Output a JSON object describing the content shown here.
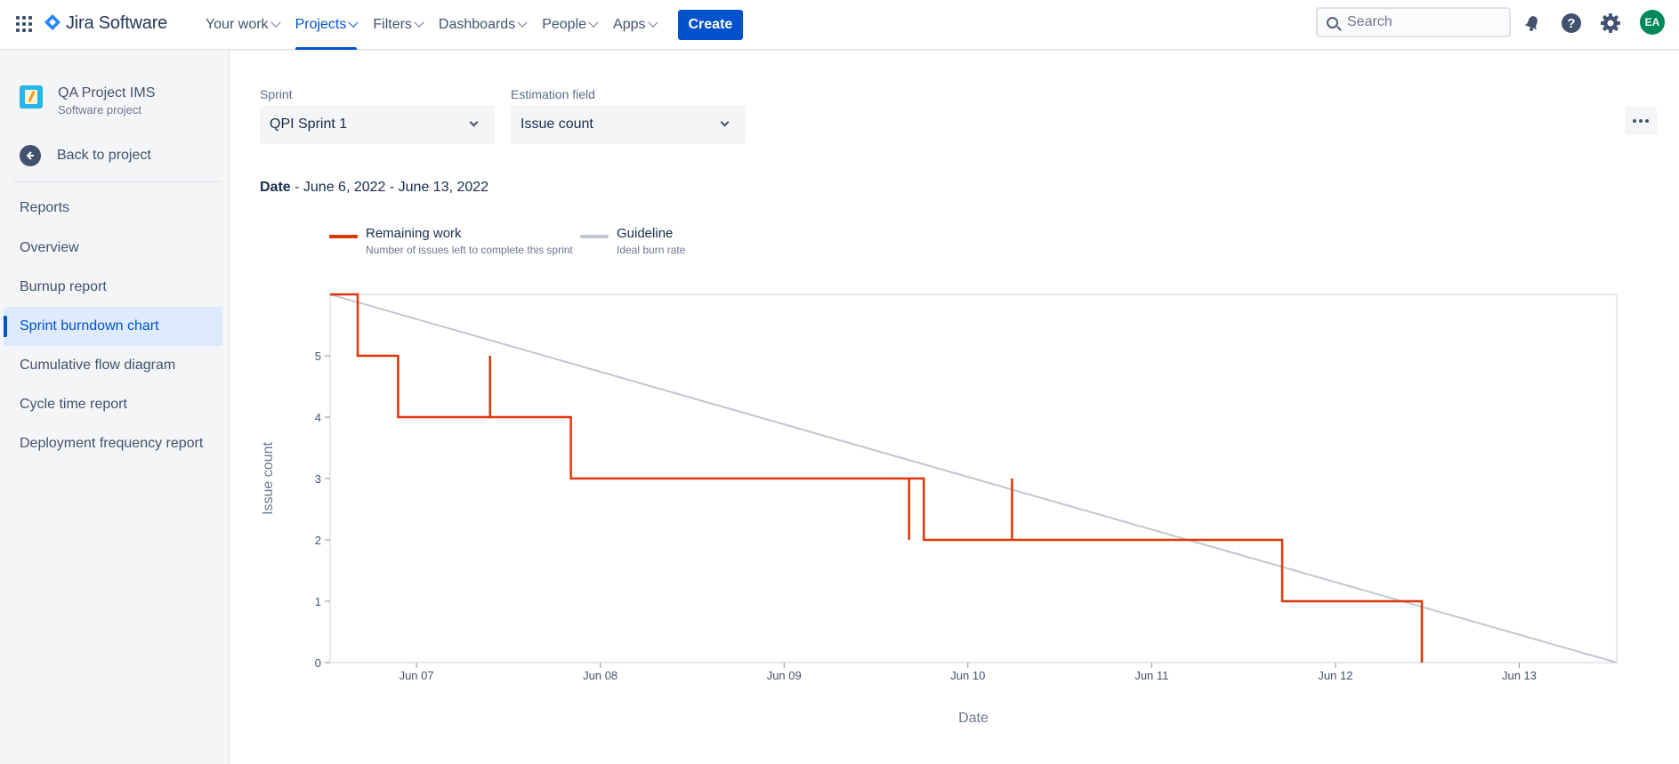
{
  "nav": {
    "product": "Jira Software",
    "items": [
      {
        "label": "Your work",
        "active": false
      },
      {
        "label": "Projects",
        "active": true
      },
      {
        "label": "Filters",
        "active": false
      },
      {
        "label": "Dashboards",
        "active": false
      },
      {
        "label": "People",
        "active": false
      },
      {
        "label": "Apps",
        "active": false
      }
    ],
    "create_label": "Create",
    "search_placeholder": "Search",
    "avatar_initials": "EA",
    "icons": [
      "app-switcher-icon",
      "notifications-icon",
      "help-icon",
      "settings-icon"
    ]
  },
  "sidebar": {
    "project_name": "QA Project IMS",
    "project_type": "Software project",
    "back_label": "Back to project",
    "section_heading": "Reports",
    "items": [
      {
        "label": "Overview",
        "active": false
      },
      {
        "label": "Burnup report",
        "active": false
      },
      {
        "label": "Sprint burndown chart",
        "active": true
      },
      {
        "label": "Cumulative flow diagram",
        "active": false
      },
      {
        "label": "Cycle time report",
        "active": false
      },
      {
        "label": "Deployment frequency report",
        "active": false
      }
    ]
  },
  "filters": {
    "sprint_label": "Sprint",
    "sprint_value": "QPI Sprint 1",
    "estimation_label": "Estimation field",
    "estimation_value": "Issue count"
  },
  "date_range": {
    "label": "Date",
    "value": " - June 6, 2022 - June 13, 2022"
  },
  "legend": [
    {
      "name": "Remaining work",
      "description": "Number of issues left to complete this sprint",
      "color": "#de350b"
    },
    {
      "name": "Guideline",
      "description": "Ideal burn rate",
      "color": "#c1c7d0"
    }
  ],
  "chart_data": {
    "type": "line",
    "xlabel": "Date",
    "ylabel": "Issue count",
    "x_ticks": [
      "Jun 07",
      "Jun 08",
      "Jun 09",
      "Jun 10",
      "Jun 11",
      "Jun 12",
      "Jun 13"
    ],
    "y_ticks": [
      0,
      1,
      2,
      3,
      4,
      5
    ],
    "x_range_days": [
      -0.47,
      6.53
    ],
    "ylim": [
      0,
      6
    ],
    "grid": false,
    "legend_position": "top-left",
    "series": [
      {
        "name": "Remaining work",
        "color": "#de350b",
        "step_points": [
          [
            -0.47,
            6
          ],
          [
            -0.32,
            6
          ],
          [
            -0.32,
            5
          ],
          [
            -0.1,
            5
          ],
          [
            -0.1,
            4
          ],
          [
            0.4,
            4
          ],
          [
            0.4,
            5
          ],
          [
            0.4,
            4
          ],
          [
            0.84,
            4
          ],
          [
            0.84,
            3
          ],
          [
            2.68,
            3
          ],
          [
            2.68,
            2
          ],
          [
            2.68,
            3
          ],
          [
            2.76,
            3
          ],
          [
            2.76,
            2
          ],
          [
            3.24,
            2
          ],
          [
            3.24,
            3
          ],
          [
            3.24,
            2
          ],
          [
            4.71,
            2
          ],
          [
            4.71,
            1
          ],
          [
            5.47,
            1
          ],
          [
            5.47,
            0
          ]
        ]
      },
      {
        "name": "Guideline",
        "color": "#c1c7d0",
        "points": [
          [
            -0.47,
            6
          ],
          [
            6.53,
            0
          ]
        ]
      }
    ]
  }
}
